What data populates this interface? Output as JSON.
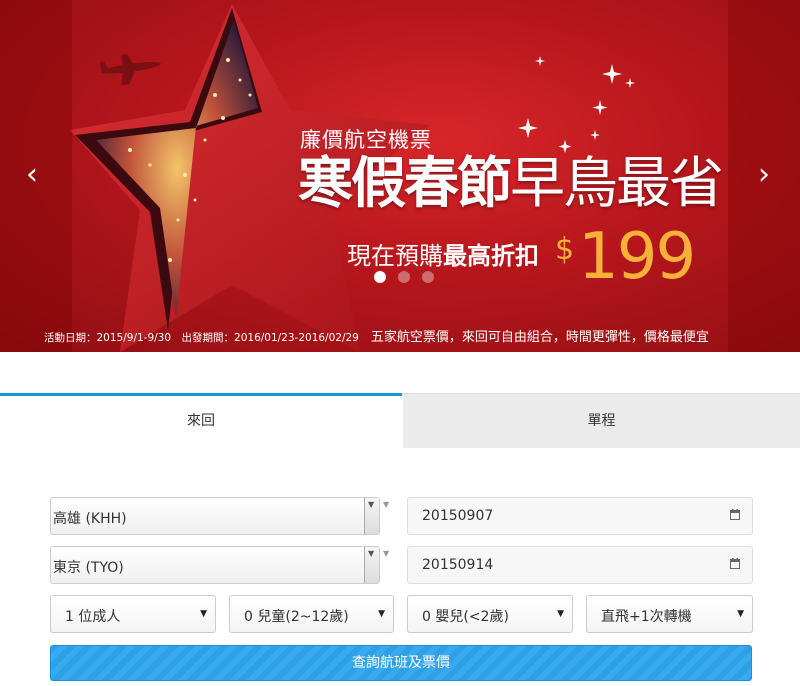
{
  "banner": {
    "prev_arrow": "‹",
    "next_arrow": "›",
    "subtitle": "廉價航空機票",
    "headline_bold": "寒假春節",
    "headline_light": "早鳥最省",
    "promo_prefix": "現在預購",
    "promo_bold": "最高折扣",
    "price_currency": "$",
    "price_value": "199",
    "slide_count": 3,
    "active_slide": 1,
    "footnote_dates": "活動日期：2015/9/1-9/30　出發期間：2016/01/23-2016/02/29",
    "footnote_tagline": "五家航空票價，來回可自由組合，時間更彈性，價格最便宜",
    "colors": {
      "background": "#b5161b",
      "price": "#f7b13a"
    }
  },
  "tabs": {
    "round_trip": "來回",
    "one_way": "單程",
    "active": "round_trip",
    "accent_color": "#1e90d8"
  },
  "form": {
    "origin": {
      "value": "高雄 (KHH)"
    },
    "destination": {
      "value": "東京 (TYO)"
    },
    "depart_date": {
      "value": "20150907"
    },
    "return_date": {
      "value": "20150914"
    },
    "adults": {
      "value": "1 位成人"
    },
    "children": {
      "value": "0 兒童(2~12歲)"
    },
    "infants": {
      "value": "0 嬰兒(<2歲)"
    },
    "stops": {
      "value": "直飛+1次轉機"
    },
    "submit_label": "查詢航班及票價",
    "submit_color": "#2ea0e6"
  },
  "icons": {
    "combo_toggle": "▼",
    "select_caret": "▼",
    "calendar": "calendar-icon",
    "airplane": "airplane-icon",
    "sparkles": "sparkle-icon"
  }
}
